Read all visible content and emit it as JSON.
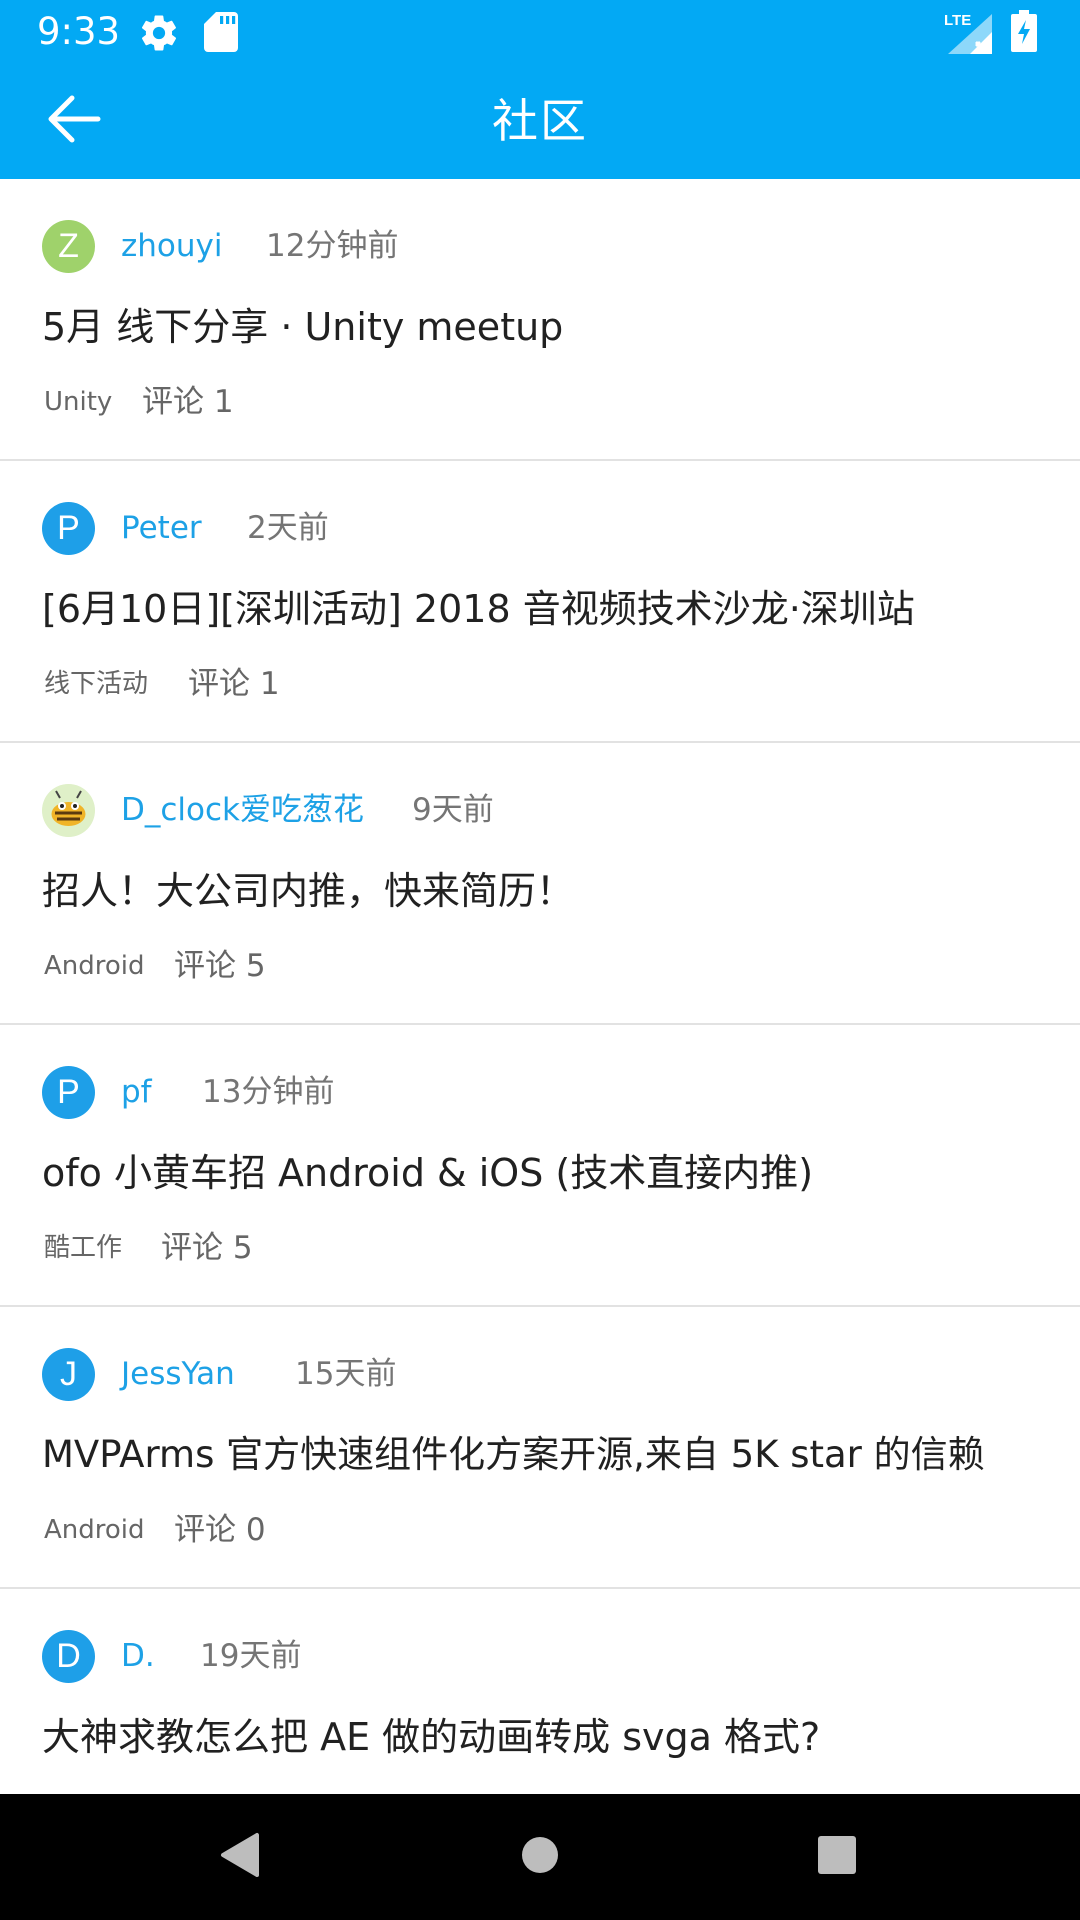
{
  "status_bar": {
    "time": "9:33",
    "network": "LTE",
    "icons": [
      "gear-icon",
      "sd-card-icon",
      "signal-icon",
      "battery-charging-icon"
    ]
  },
  "app_bar": {
    "title": "社区",
    "back_icon": "arrow-left-icon"
  },
  "colors": {
    "primary": "#03a9f4",
    "username": "#1da1e6",
    "title_text": "#212121",
    "meta_text": "#757575",
    "avatar_z": "#9fd26b",
    "avatar_letter": "#1e9fe8"
  },
  "posts": [
    {
      "avatar_letter": "Z",
      "username": "zhouyi",
      "time": "12分钟前",
      "title": "5月 线下分享 · Unity meetup",
      "category": "Unity",
      "comments": "评论 1"
    },
    {
      "avatar_letter": "P",
      "username": "Peter",
      "time": "2天前",
      "title": "[6月10日][深圳活动] 2018 音视频技术沙龙·深圳站",
      "category": "线下活动",
      "comments": "评论 1"
    },
    {
      "avatar_letter": "",
      "username": "D_clock爱吃葱花",
      "time": "9天前",
      "title": "招人！大公司内推，快来简历！",
      "category": "Android",
      "comments": "评论 5"
    },
    {
      "avatar_letter": "P",
      "username": "pf",
      "time": "13分钟前",
      "title": "ofo 小黄车招 Android & iOS (技术直接内推)",
      "category": "酷工作",
      "comments": "评论 5"
    },
    {
      "avatar_letter": "J",
      "username": "JessYan",
      "time": "15天前",
      "title": "MVPArms 官方快速组件化方案开源,来自 5K star 的信赖",
      "category": "Android",
      "comments": "评论 0"
    },
    {
      "avatar_letter": "D",
      "username": "D.",
      "time": "19天前",
      "title": "大神求教怎么把 AE 做的动画转成 svga 格式?",
      "category": "",
      "comments": ""
    }
  ],
  "nav_bar": {
    "icons": [
      "back-triangle-icon",
      "home-circle-icon",
      "recents-square-icon"
    ]
  }
}
